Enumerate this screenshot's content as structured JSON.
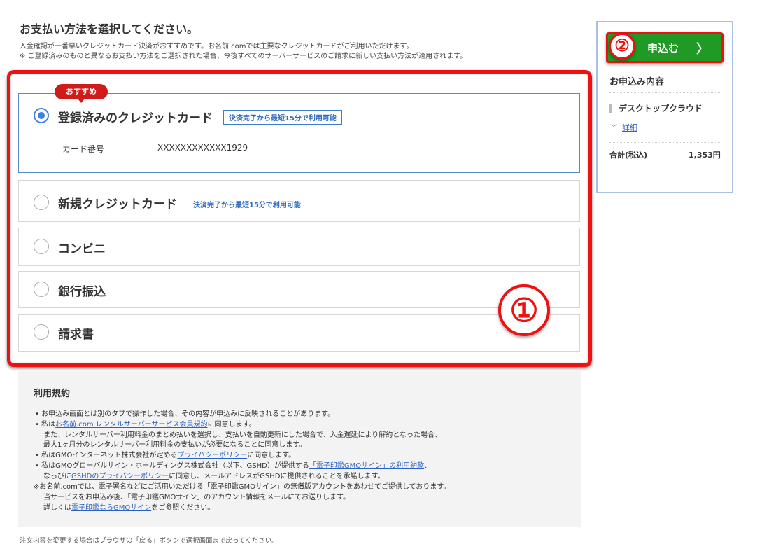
{
  "page": {
    "title": "お支払い方法を選択してください。",
    "subtitle_1": "入金確認が一番早いクレジットカード決済がおすすめです。お名前.comでは主要なクレジットカードがご利用いただけます。",
    "subtitle_2": "※ ご登録済みのものと異なるお支払い方法をご選択された場合、今後すべてのサーバーサービスのご請求に新しい支払い方法が適用されます。"
  },
  "annotations": {
    "circle_1": "①",
    "circle_2": "②",
    "highlight_color": "#ee1111"
  },
  "payment_options": {
    "recommended_tag": "おすすめ",
    "registered_card": {
      "label": "登録済みのクレジットカード",
      "badge": "決済完了から最短15分で利用可能",
      "card_number_label": "カード番号",
      "card_number_value": "XXXXXXXXXXXX1929",
      "selected": true
    },
    "new_card": {
      "label": "新規クレジットカード",
      "badge": "決済完了から最短15分で利用可能",
      "selected": false
    },
    "convenience_store": {
      "label": "コンビニ",
      "selected": false
    },
    "bank_transfer": {
      "label": "銀行振込",
      "selected": false
    },
    "invoice": {
      "label": "請求書",
      "selected": false
    },
    "accent_color": "#3d82e0"
  },
  "terms": {
    "title": "利用規約",
    "line1": "• お申込み画面とは別のタブで操作した場合、その内容が申込みに反映されることがあります。",
    "line2_pre": "• 私は",
    "line2_link": "お名前.com レンタルサーバーサービス会員規約",
    "line2_post": "に同意します。",
    "line3": "また、レンタルサーバー利用料金のまとめ払いを選択し、支払いを自動更新にした場合で、入金遅延により解約となった場合、",
    "line4": "最大1ヶ月分のレンタルサーバー利用料金の支払いが必要になることに同意します。",
    "line5_pre": "• 私はGMOインターネット株式会社が定める",
    "line5_link": "プライバシーポリシー",
    "line5_post": "に同意します。",
    "line6_pre": "• 私はGMOグローバルサイン・ホールディングス株式会社（以下、GSHD）が提供する",
    "line6_link": "「電子印鑑GMOサイン」の利用約款",
    "line6_post": "、",
    "line7_pre": "ならびに",
    "line7_link": "GSHDのプライバシーポリシー",
    "line7_post": "に同意し、メールアドレスがGSHDに提供されることを承諾します。",
    "line8": "※お名前.comでは、電子署名などにご活用いただける「電子印鑑GMOサイン」の無償版アカウントをあわせてご提供しております。",
    "line9": "当サービスをお申込み後、「電子印鑑GMOサイン」のアカウント情報をメールにてお送りします。",
    "line10_pre": "詳しくは",
    "line10_link": "電子印鑑ならGMOサイン",
    "line10_post": "をご参照ください。",
    "footnote": "注文内容を変更する場合はブラウザの「戻る」ボタンで選択画面まで戻ってください。"
  },
  "sidebar": {
    "apply_button": "申込む",
    "apply_chevron": "〉",
    "summary_title": "お申込み内容",
    "product": "デスクトップクラウド",
    "detail_chevron": "﹀",
    "detail_link": "詳細",
    "total_label": "合計(税込)",
    "total_value": "1,353円",
    "button_color": "#1f9a24"
  }
}
